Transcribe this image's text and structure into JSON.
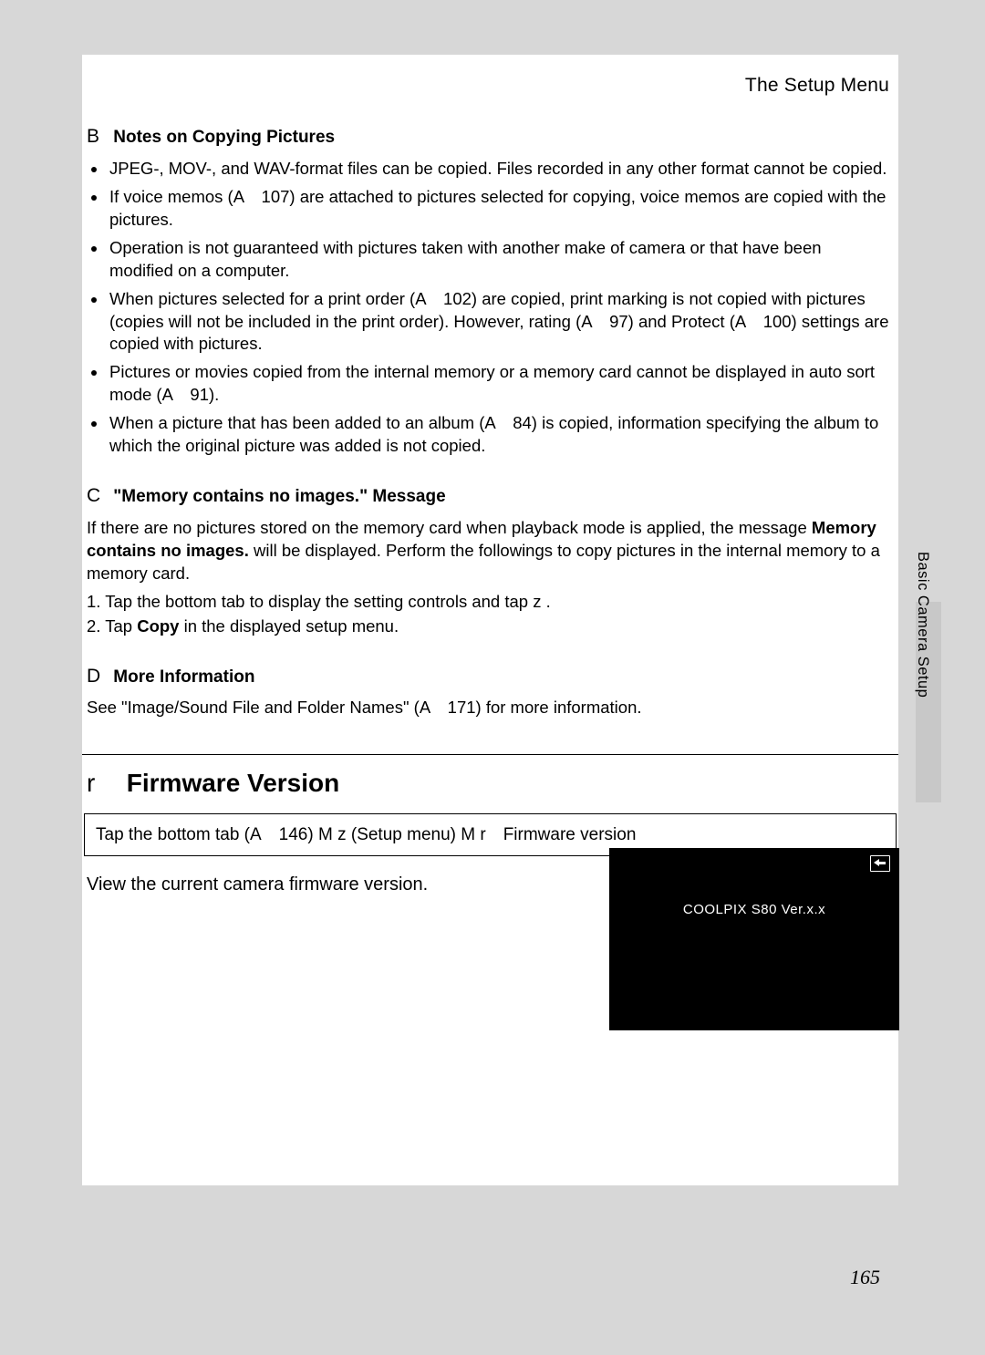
{
  "header": {
    "title": "The Setup Menu"
  },
  "sec1": {
    "sym": "B",
    "title": "Notes on Copying Pictures",
    "bullets": [
      "JPEG-, MOV-, and WAV-format files can be copied. Files recorded in any other format cannot be copied.",
      "If voice memos (A 107) are attached to pictures selected for copying, voice memos are copied with the pictures.",
      "Operation is not guaranteed with pictures taken with another make of camera or that have been modified on a computer.",
      "When pictures selected for a print order (A 102) are copied, print marking is not copied with pictures (copies will not be included in the print order). However, rating (A 97) and Protect (A 100) settings are copied with pictures.",
      "Pictures or movies copied from the internal memory or a memory card cannot be displayed in auto sort mode (A 91).",
      "When a picture that has been added to an album (A 84) is copied, information specifying the album to which the original picture was added is not copied."
    ]
  },
  "sec2": {
    "sym": "C",
    "title": "\"Memory contains no images.\" Message",
    "para_pre": "If there are no pictures stored on the memory card when playback mode is applied, the message ",
    "para_bold": "Memory contains no images.",
    "para_post": " will be displayed. Perform the followings to copy pictures in the internal memory to a memory card.",
    "step1_pre": "1.  Tap the bottom tab to display the setting controls and tap ",
    "step1_sym": "z",
    "step1_post": " .",
    "step2_pre": "2.  Tap ",
    "step2_bold": "Copy",
    "step2_post": " in the displayed setup menu."
  },
  "sec3": {
    "sym": "D",
    "title": "More Information",
    "para": "See \"Image/Sound File and Folder Names\" (A 171) for more information."
  },
  "fw": {
    "sym": "r",
    "title": "Firmware Version",
    "nav_a": "Tap the bottom tab (",
    "nav_b": "A 146)",
    "nav_c": " M z  (Setup menu) M r Firmware version",
    "desc": "View the current camera firmware version.",
    "screen_text": "COOLPIX S80  Ver.x.x"
  },
  "side_label": "Basic Camera Setup",
  "page_number": "165"
}
